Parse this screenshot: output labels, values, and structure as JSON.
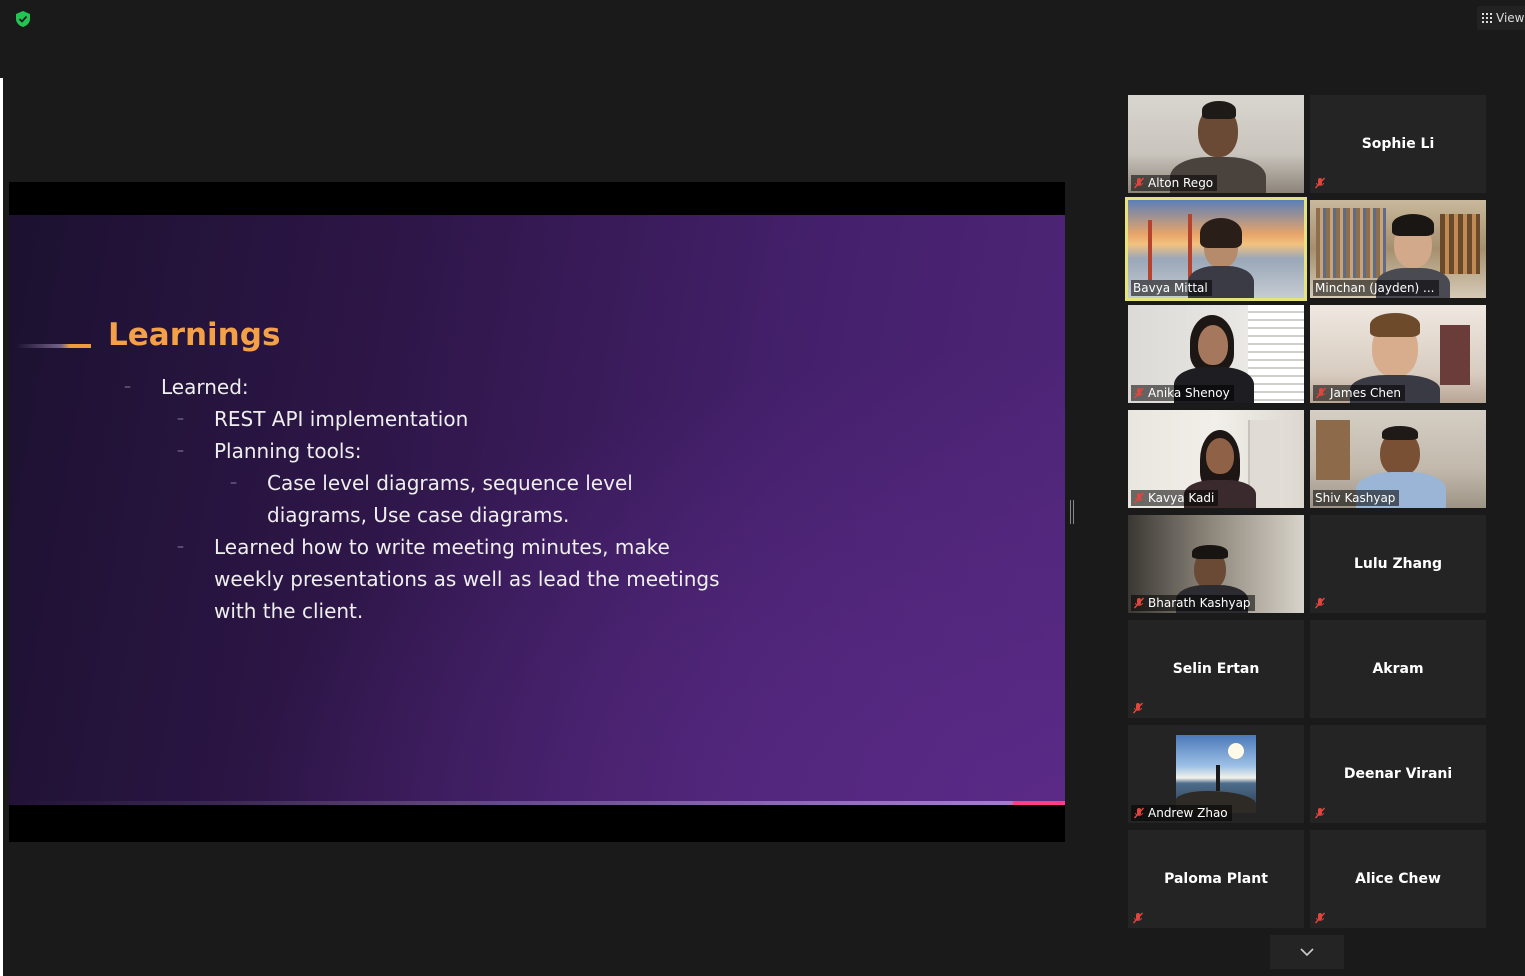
{
  "toolbar": {
    "view_label": "View"
  },
  "slide": {
    "title": "Learnings",
    "bullets": [
      {
        "level": 1,
        "text": "Learned:"
      },
      {
        "level": 2,
        "text": "REST API implementation"
      },
      {
        "level": 2,
        "text": "Planning tools:"
      },
      {
        "level": 3,
        "lines": [
          "Case level diagrams, sequence level",
          "diagrams, Use case diagrams."
        ]
      },
      {
        "level": 2,
        "lines": [
          "Learned how to write meeting minutes, make",
          "weekly presentations as well as lead the meetings",
          "with the client."
        ]
      }
    ]
  },
  "participants": [
    {
      "name": "Alton Rego",
      "video": true,
      "muted": true
    },
    {
      "name": "Sophie Li",
      "video": false,
      "muted": true
    },
    {
      "name": "Bavya Mittal",
      "video": true,
      "muted": false,
      "active_speaker": true
    },
    {
      "name": "Minchan (Jayden) ...",
      "video": true,
      "muted": false
    },
    {
      "name": "Anika Shenoy",
      "video": true,
      "muted": true
    },
    {
      "name": "James Chen",
      "video": true,
      "muted": true
    },
    {
      "name": "Kavya Kadi",
      "video": true,
      "muted": true
    },
    {
      "name": "Shiv Kashyap",
      "video": true,
      "muted": false
    },
    {
      "name": "Bharath Kashyap",
      "video": true,
      "muted": true
    },
    {
      "name": "Lulu Zhang",
      "video": false,
      "muted": true
    },
    {
      "name": "Selin Ertan",
      "video": false,
      "muted": true
    },
    {
      "name": "Akram",
      "video": false,
      "muted": false
    },
    {
      "name": "Andrew Zhao",
      "video": false,
      "avatar": true,
      "muted": true
    },
    {
      "name": "Deenar Virani",
      "video": false,
      "muted": true
    },
    {
      "name": "Paloma Plant",
      "video": false,
      "muted": true
    },
    {
      "name": "Alice Chew",
      "video": false,
      "muted": true
    }
  ],
  "colors": {
    "title_orange": "#f3a047",
    "active_border": "#e6e37a",
    "muted_red": "#e0463e",
    "security_green": "#23c552"
  }
}
